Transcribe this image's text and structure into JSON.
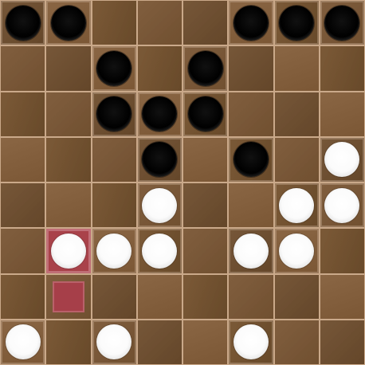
{
  "game": {
    "rows": 8,
    "cols": 8,
    "pieces": [
      {
        "r": 0,
        "c": 0,
        "color": "black"
      },
      {
        "r": 0,
        "c": 1,
        "color": "black"
      },
      {
        "r": 0,
        "c": 5,
        "color": "black"
      },
      {
        "r": 0,
        "c": 6,
        "color": "black"
      },
      {
        "r": 0,
        "c": 7,
        "color": "black"
      },
      {
        "r": 1,
        "c": 2,
        "color": "black"
      },
      {
        "r": 1,
        "c": 4,
        "color": "black"
      },
      {
        "r": 2,
        "c": 2,
        "color": "black"
      },
      {
        "r": 2,
        "c": 3,
        "color": "black"
      },
      {
        "r": 2,
        "c": 4,
        "color": "black"
      },
      {
        "r": 3,
        "c": 3,
        "color": "black"
      },
      {
        "r": 3,
        "c": 5,
        "color": "black"
      },
      {
        "r": 3,
        "c": 7,
        "color": "white"
      },
      {
        "r": 4,
        "c": 3,
        "color": "white"
      },
      {
        "r": 4,
        "c": 6,
        "color": "white"
      },
      {
        "r": 4,
        "c": 7,
        "color": "white"
      },
      {
        "r": 5,
        "c": 1,
        "color": "white"
      },
      {
        "r": 5,
        "c": 2,
        "color": "white"
      },
      {
        "r": 5,
        "c": 3,
        "color": "white"
      },
      {
        "r": 5,
        "c": 5,
        "color": "white"
      },
      {
        "r": 5,
        "c": 6,
        "color": "white"
      },
      {
        "r": 7,
        "c": 0,
        "color": "white"
      },
      {
        "r": 7,
        "c": 2,
        "color": "white"
      },
      {
        "r": 7,
        "c": 5,
        "color": "white"
      }
    ],
    "last_move_from": {
      "r": 5,
      "c": 1
    },
    "last_move_to": {
      "r": 6,
      "c": 1
    },
    "colors": {
      "black_piece": "#000000",
      "white_piece": "#ffffff",
      "highlight": "#a9424a",
      "grid_line": "#caa98a"
    }
  }
}
